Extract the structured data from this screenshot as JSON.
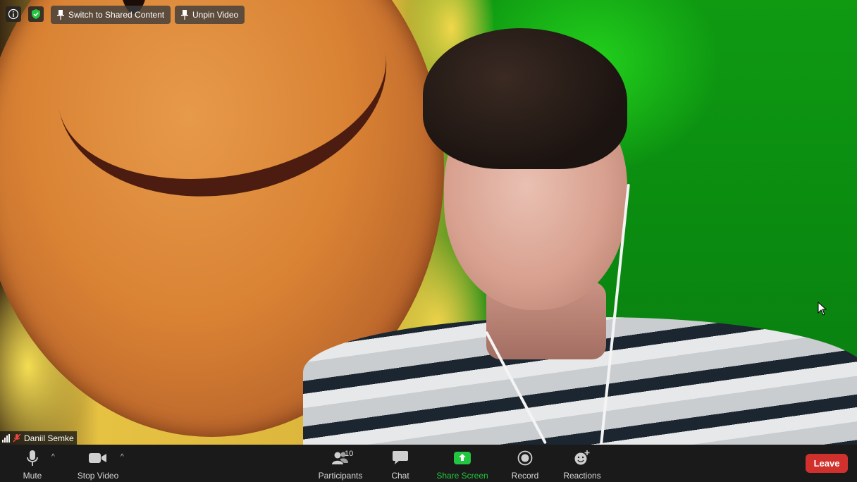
{
  "top_bar": {
    "info_icon": "info-icon",
    "security_icon": "shield-check-icon",
    "switch_label": "Switch to Shared Content",
    "unpin_label": "Unpin Video"
  },
  "participant": {
    "name": "Daniil Semke",
    "signal_icon": "signal-bars-icon",
    "mic_status_icon": "muted-mic-icon"
  },
  "toolbar": {
    "mute_label": "Mute",
    "stop_video_label": "Stop Video",
    "participants_label": "Participants",
    "participants_count": "10",
    "chat_label": "Chat",
    "share_screen_label": "Share Screen",
    "record_label": "Record",
    "reactions_label": "Reactions",
    "leave_label": "Leave"
  },
  "colors": {
    "share_screen_accent": "#23c63f",
    "leave_red": "#d0312d",
    "toolbar_bg": "#1a1a1a",
    "security_green": "#23c63f"
  }
}
